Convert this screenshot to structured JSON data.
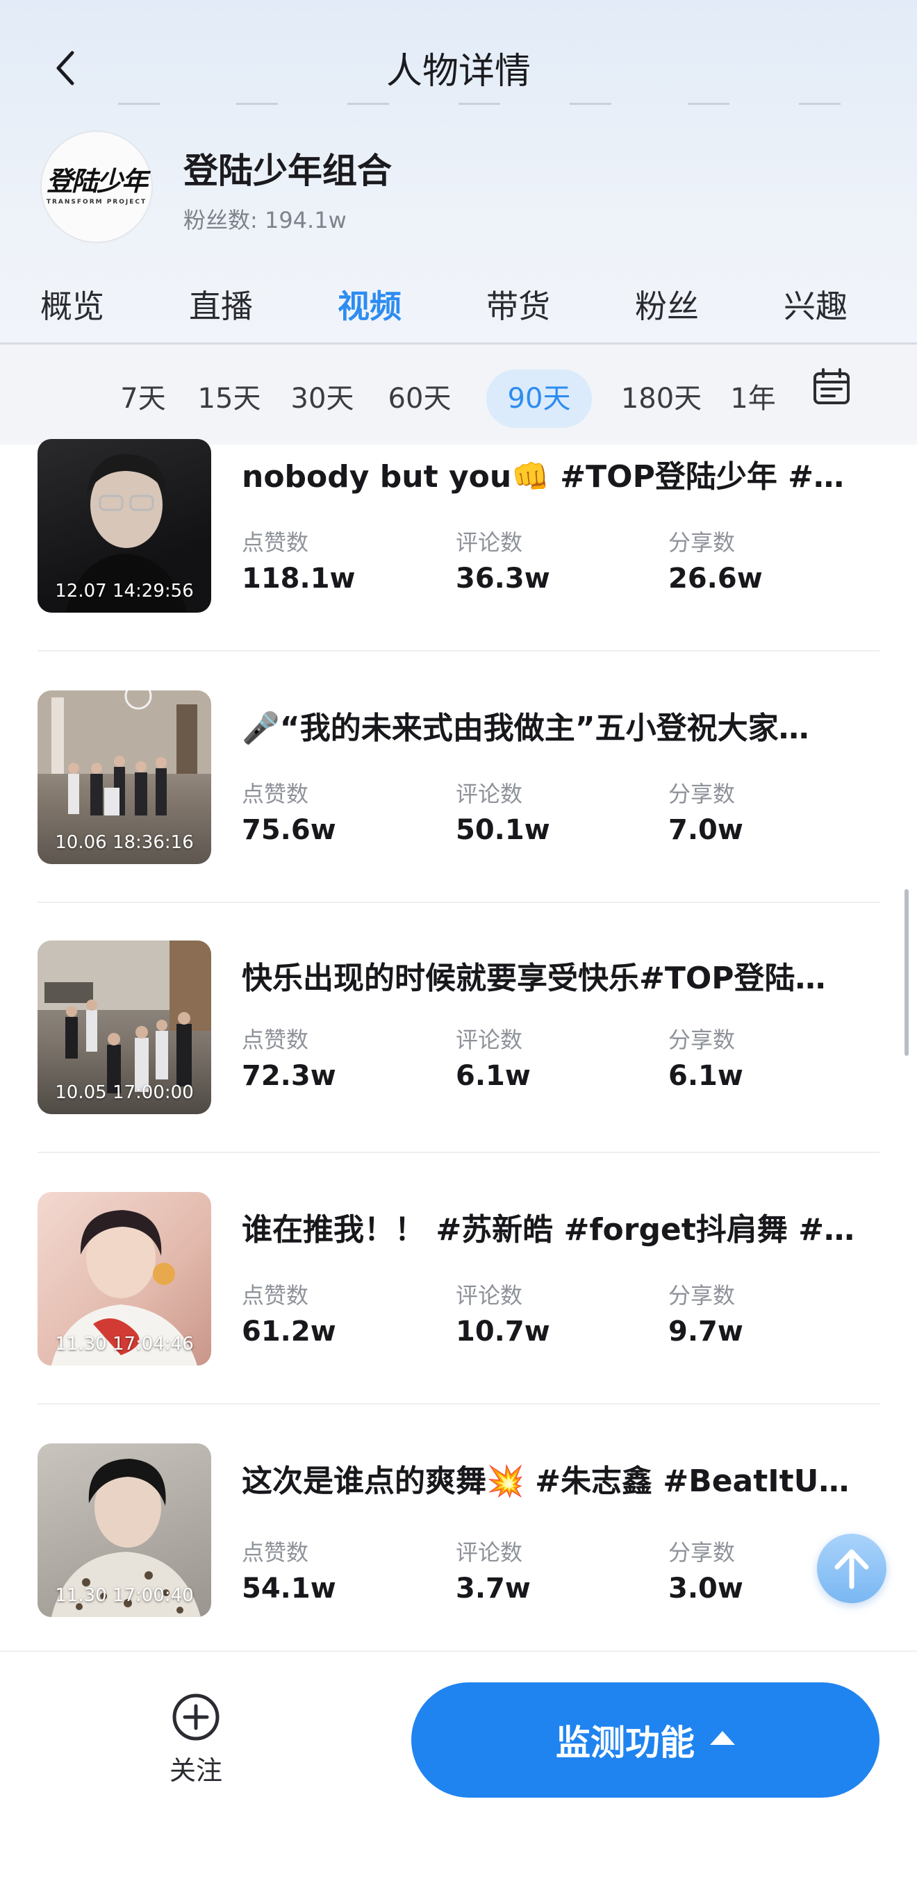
{
  "header": {
    "title": "人物详情"
  },
  "profile": {
    "name": "登陆少年组合",
    "fans": "粉丝数: 194.1w",
    "logo_main": "登陆少年",
    "logo_sub": "TRANSFORM PROJECT"
  },
  "tabs": [
    {
      "label": "概览",
      "active": false
    },
    {
      "label": "直播",
      "active": false
    },
    {
      "label": "视频",
      "active": true
    },
    {
      "label": "带货",
      "active": false
    },
    {
      "label": "粉丝",
      "active": false
    },
    {
      "label": "兴趣",
      "active": false
    }
  ],
  "periods": [
    {
      "label": "7天",
      "active": false
    },
    {
      "label": "15天",
      "active": false
    },
    {
      "label": "30天",
      "active": false
    },
    {
      "label": "60天",
      "active": false
    },
    {
      "label": "90天",
      "active": true
    },
    {
      "label": "180天",
      "active": false
    },
    {
      "label": "1年",
      "active": false
    }
  ],
  "stat_labels": {
    "likes": "点赞数",
    "comments": "评论数",
    "shares": "分享数"
  },
  "videos": [
    {
      "time": "12.07 14:29:56",
      "title": "nobody but you👊 #TOP登陆少年 #朱…",
      "likes": "118.1w",
      "comments": "36.3w",
      "shares": "26.6w"
    },
    {
      "time": "10.06 18:36:16",
      "title": "🎤“我的未来式由我做主”五小登祝大家…",
      "likes": "75.6w",
      "comments": "50.1w",
      "shares": "7.0w"
    },
    {
      "time": "10.05 17:00:00",
      "title": "快乐出现的时候就要享受快乐#TOP登陆…",
      "likes": "72.3w",
      "comments": "6.1w",
      "shares": "6.1w"
    },
    {
      "time": "11.30 17:04:46",
      "title": "谁在推我！！ #苏新皓 #forget抖肩舞 #…",
      "likes": "61.2w",
      "comments": "10.7w",
      "shares": "9.7w"
    },
    {
      "time": "11.30 17:00:40",
      "title": "这次是谁点的爽舞💥 #朱志鑫 #BeatItU…",
      "likes": "54.1w",
      "comments": "3.7w",
      "shares": "3.0w"
    }
  ],
  "bottom": {
    "follow_label": "关注",
    "monitor_label": "监测功能"
  },
  "colors": {
    "accent": "#2d8cf0",
    "button": "#1f84f0"
  }
}
